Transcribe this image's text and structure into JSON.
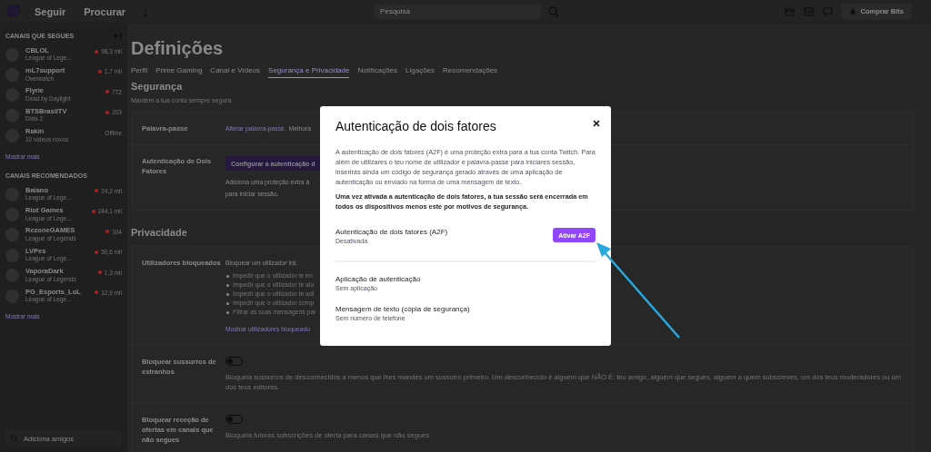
{
  "top_bar": {
    "nav": [
      "Seguir",
      "Procurar"
    ],
    "search": {
      "placeholder": "Pesquisa"
    },
    "buy_bits": "Comprar Bits"
  },
  "sidebar": {
    "followed_header": "CANAIS QUE SEGUES",
    "followed": [
      {
        "name": "CBLOL",
        "game": "League of Lege...",
        "viewers": "98,3 mil",
        "live": true
      },
      {
        "name": "mL7support",
        "game": "Overwatch",
        "viewers": "1,7 mil",
        "live": true
      },
      {
        "name": "Flyrie",
        "game": "Dead by Daylight",
        "viewers": "772",
        "live": true
      },
      {
        "name": "BTSBrasilTV",
        "game": "Dota 2",
        "viewers": "203",
        "live": true
      },
      {
        "name": "Rakin",
        "game": "10 vídeos novos",
        "viewers": "Offline",
        "live": false
      }
    ],
    "followed_more": "Mostrar mais",
    "recommended_header": "CANAIS RECOMENDADOS",
    "recommended": [
      {
        "name": "Baiano",
        "game": "League of Lege...",
        "viewers": "24,2 mil",
        "live": true
      },
      {
        "name": "Riot Games",
        "game": "League of Lege...",
        "viewers": "244,1 mil",
        "live": true
      },
      {
        "name": "RezoneGAMES",
        "game": "League of Legends",
        "viewers": "104",
        "live": true
      },
      {
        "name": "LVPes",
        "game": "League of Lege...",
        "viewers": "50,6 mil",
        "live": true
      },
      {
        "name": "VaporaDark",
        "game": "League of Legends",
        "viewers": "1,3 mil",
        "live": true
      },
      {
        "name": "PG_Esports_LoL",
        "game": "League of Lege...",
        "viewers": "12,9 mil",
        "live": true
      }
    ],
    "recommended_more": "Mostrar mais",
    "friend_search": {
      "placeholder": "Adiciona amigos"
    }
  },
  "settings": {
    "title": "Definições",
    "tabs": [
      {
        "label": "Perfil",
        "selected": false
      },
      {
        "label": "Prime Gaming",
        "selected": false
      },
      {
        "label": "Canal e Vídeos",
        "selected": false
      },
      {
        "label": "Segurança e Privacidade",
        "selected": true
      },
      {
        "label": "Notificações",
        "selected": false
      },
      {
        "label": "Ligações",
        "selected": false
      },
      {
        "label": "Recomendações",
        "selected": false
      }
    ],
    "sections": [
      {
        "heading": "Segurança",
        "subtitle": "Mantém a tua conta sempre segura",
        "rows": [
          {
            "kind": "link",
            "label": "Palavra-passe",
            "link": "Alterar palavra-passe.",
            "text": "Melhora"
          },
          {
            "kind": "button",
            "label": "Autenticação de Dois Fatores",
            "button": "Configurar a autenticação d",
            "lines": [
              "Adiciona uma proteção extra à",
              "para iniciar sessão."
            ]
          }
        ]
      },
      {
        "heading": "Privacidade",
        "rows": [
          {
            "kind": "list",
            "label": "Utilizadores bloqueados",
            "intro": "Bloquear um utilizador irá:",
            "items": [
              "Impedir que o utilizador te en",
              "Impedir que o utilizador te alo",
              "Impedir que o utilizador te adi",
              "Impedir que o utilizador comp",
              "Filtrar as suas mensagens par"
            ],
            "link": "Mostrar utilizadores bloqueado"
          },
          {
            "kind": "toggle",
            "label": "Bloquear sussurros de estranhos",
            "on": false,
            "description": "Bloqueia sussurros de desconhecidos a menos que lhes mandes um sussurro primeiro. Um desconhecido é alguém que NÃO É: teu amigo, alguém que segues, alguém a quem subscreves, um dos teus moderadores ou um dos teus editores."
          },
          {
            "kind": "toggle",
            "label": "Bloquear receção de ofertas em canais que não segues",
            "on": false,
            "description": "Bloqueia futuras subscrições de oferta para canais que não segues"
          }
        ]
      }
    ]
  },
  "modal": {
    "title": "Autenticação de dois fatores",
    "intro": "A autenticação de dois fatores (A2F) é uma proteção extra para a tua conta Twitch. Para além de utilizares o teu nome de utilizador e palavra-passe para iniciares sessão, inserirás ainda um código de segurança gerado através de uma aplicação de autenticação ou enviado na forma de uma mensagem de texto.",
    "warning": "Uma vez ativada a autenticação de dois fatores, a tua sessão será encerrada em todos os dispositivos menos este por motivos de segurança.",
    "primary": {
      "title": "Autenticação de dois fatores (A2F)",
      "status": "Desativada",
      "button": "Ativar A2F"
    },
    "methods": [
      {
        "title": "Aplicação de autenticação",
        "status": "Sem aplicação"
      },
      {
        "title": "Mensagem de texto (cópia de segurança)",
        "status": "Sem número de telefone"
      }
    ]
  }
}
